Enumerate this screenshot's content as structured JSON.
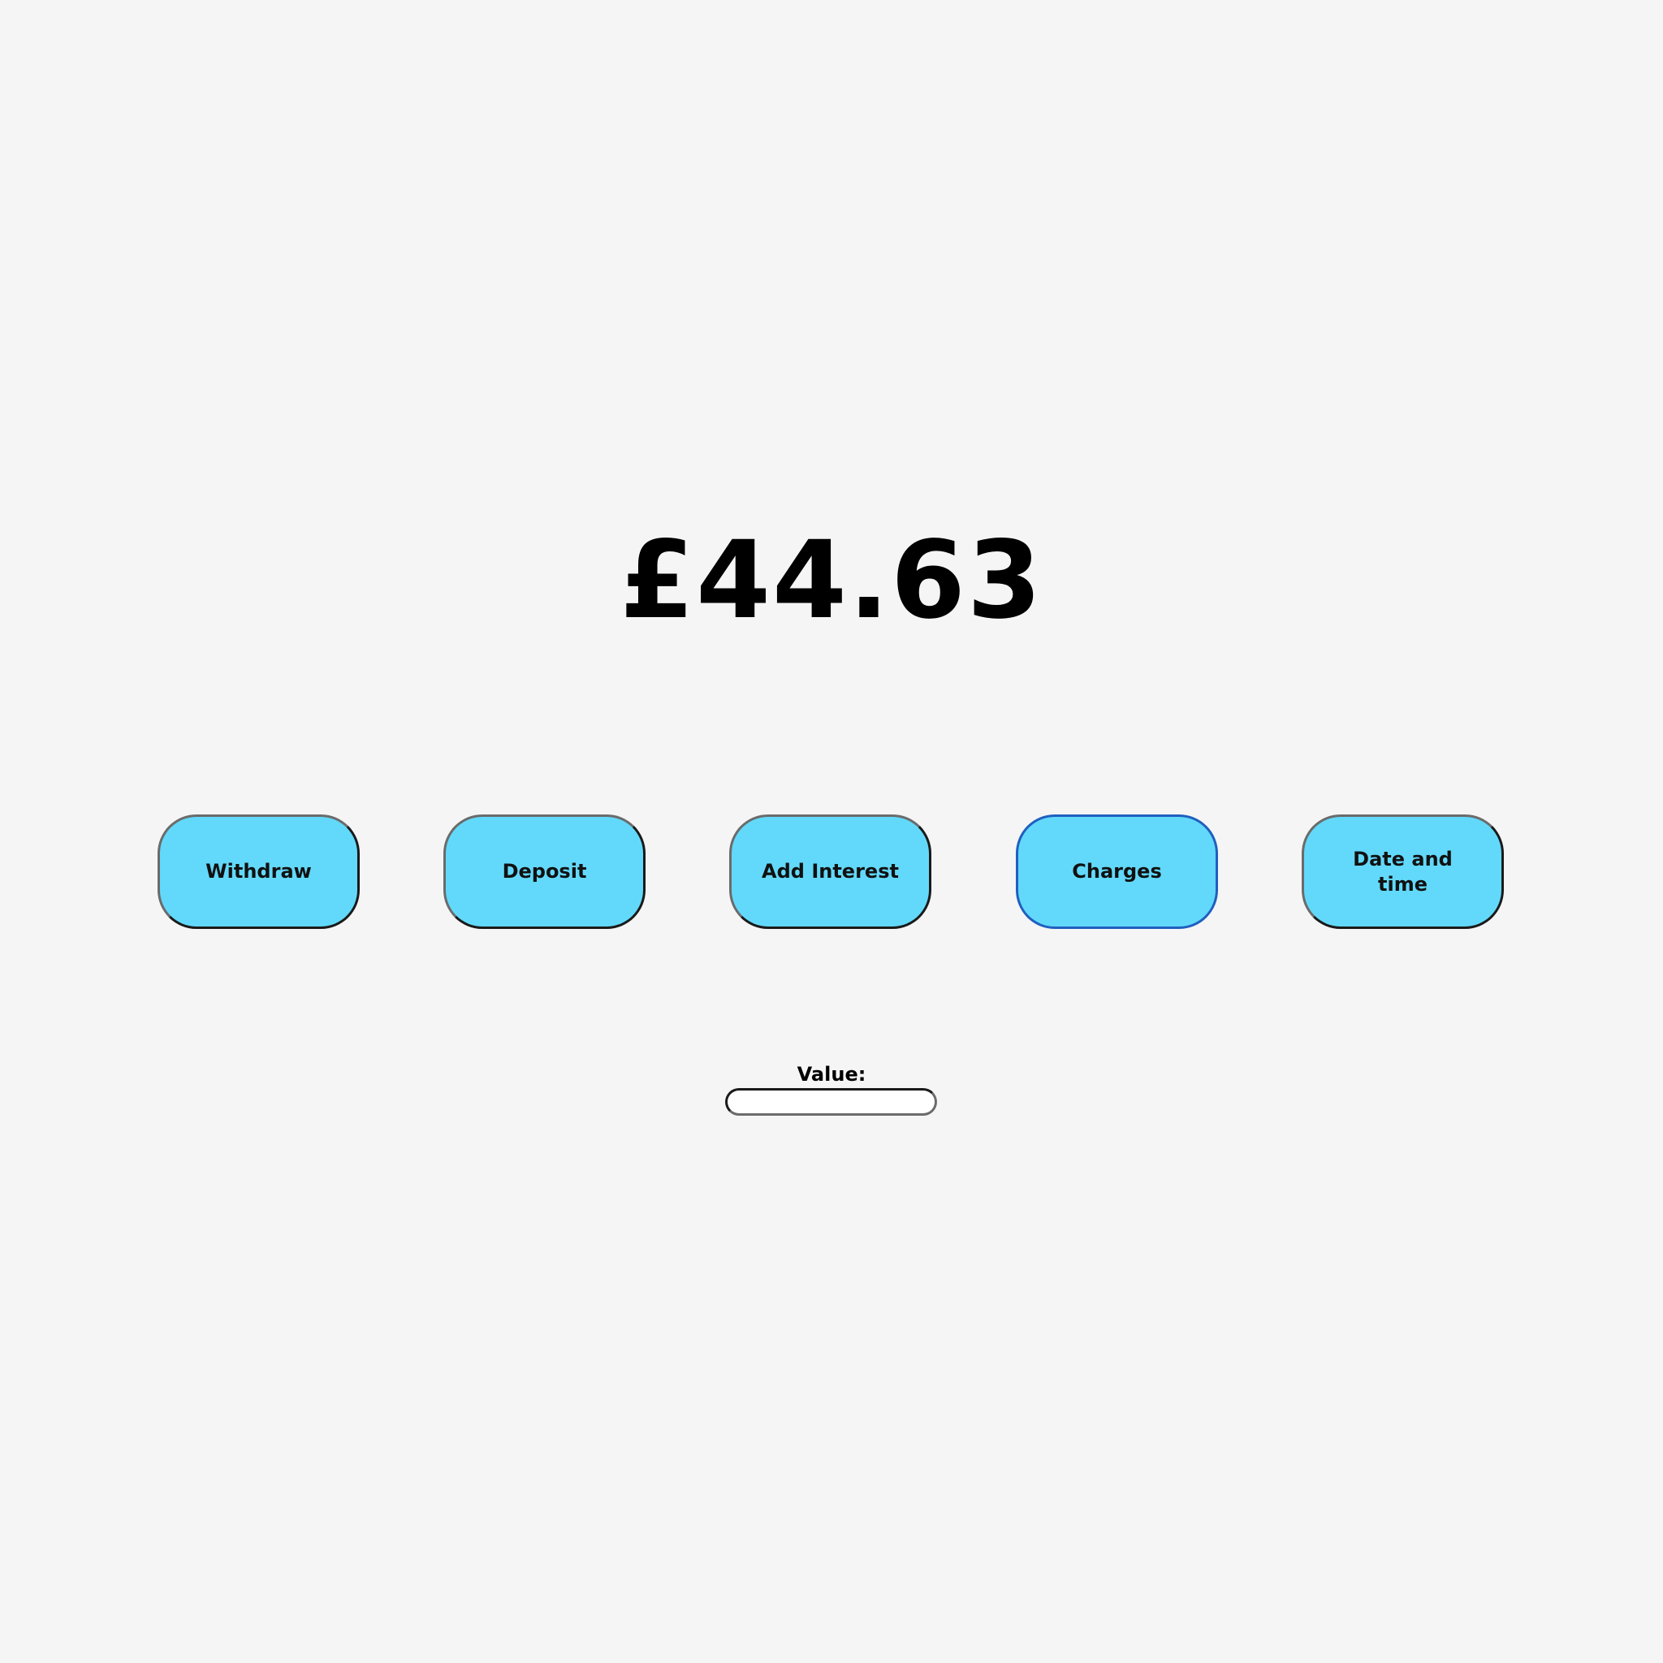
{
  "balance": "£44.63",
  "buttons": {
    "withdraw": "Withdraw",
    "deposit": "Deposit",
    "add_interest": "Add Interest",
    "charges": "Charges",
    "date_time": "Date and time"
  },
  "value_field": {
    "label": "Value:",
    "value": "",
    "placeholder": ""
  },
  "colors": {
    "background": "#f5f5f5",
    "button_fill": "#62d9fa",
    "focus_border": "#1f5fbf"
  }
}
